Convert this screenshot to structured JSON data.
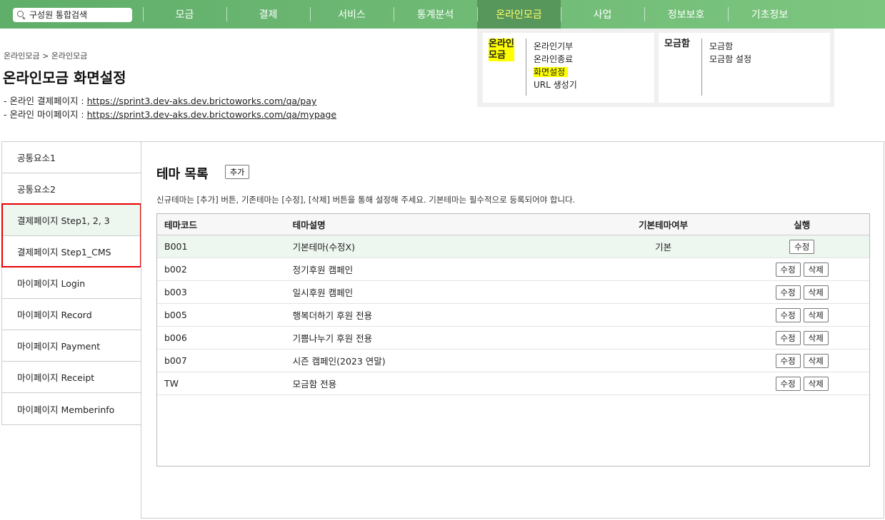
{
  "search": {
    "placeholder": "구성원 통합검색"
  },
  "nav": {
    "items": [
      {
        "label": "모금"
      },
      {
        "label": "결제"
      },
      {
        "label": "서비스"
      },
      {
        "label": "통계분석"
      },
      {
        "label": "온라인모금"
      },
      {
        "label": "사업"
      },
      {
        "label": "정보보호"
      },
      {
        "label": "기초정보"
      }
    ],
    "active_index": 4
  },
  "dropdown": {
    "group1": {
      "title": "온라인\n모금",
      "items": [
        "온라인기부",
        "온라인종료",
        "화면설정",
        "URL 생성기"
      ]
    },
    "group2": {
      "title": "모금함",
      "items": [
        "모금함",
        "모금함 설정"
      ]
    }
  },
  "breadcrumb": "온라인모금 > 온라인모금",
  "page_title": "온라인모금 화면설정",
  "info": {
    "pay_label": "- 온라인 결제페이지 : ",
    "pay_url": "https://sprint3.dev-aks.dev.brictoworks.com/qa/pay",
    "mypage_label": "- 온라인 마이페이지 : ",
    "mypage_url": "https://sprint3.dev-aks.dev.brictoworks.com/qa/mypage"
  },
  "sidebar": {
    "items": [
      {
        "label": "공통요소1"
      },
      {
        "label": "공통요소2"
      },
      {
        "label": "결제페이지 Step1, 2, 3"
      },
      {
        "label": "결제페이지 Step1_CMS"
      },
      {
        "label": "마이페이지 Login"
      },
      {
        "label": "마이페이지 Record"
      },
      {
        "label": "마이페이지 Payment"
      },
      {
        "label": "마이페이지 Receipt"
      },
      {
        "label": "마이페이지 Memberinfo"
      }
    ]
  },
  "main": {
    "title": "테마 목록",
    "add_label": "추가",
    "description": "신규테마는 [추가] 버튼, 기존테마는 [수정], [삭제] 버튼을 통해 설정해 주세요. 기본테마는 필수적으로 등록되어야 합니다.",
    "table": {
      "headers": [
        "테마코드",
        "테마설명",
        "기본테마여부",
        "실행"
      ],
      "edit_label": "수정",
      "delete_label": "삭제",
      "rows": [
        {
          "code": "B001",
          "desc": "기본테마(수정X)",
          "default": "기본"
        },
        {
          "code": "b002",
          "desc": "정기후원 캠페인",
          "default": ""
        },
        {
          "code": "b003",
          "desc": "일시후원 캠페인",
          "default": ""
        },
        {
          "code": "b005",
          "desc": "행복더하기 후원 전용",
          "default": ""
        },
        {
          "code": "b006",
          "desc": "기쁨나누기 후원 전용",
          "default": ""
        },
        {
          "code": "b007",
          "desc": "시즌 캠페인(2023 연말)",
          "default": ""
        },
        {
          "code": "TW",
          "desc": "모금함 전용",
          "default": ""
        }
      ]
    }
  }
}
